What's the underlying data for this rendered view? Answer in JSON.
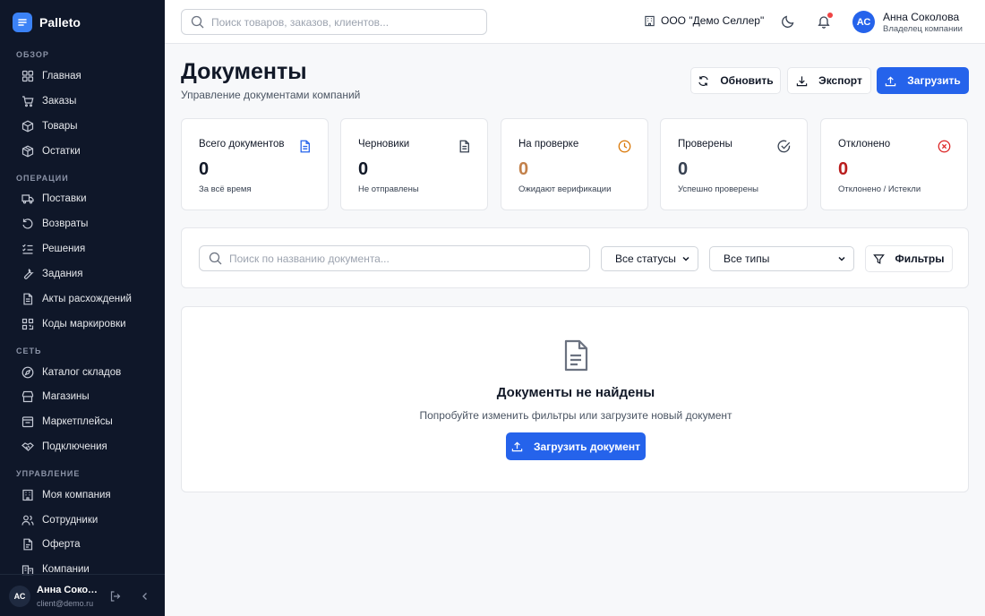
{
  "brand": {
    "name": "Palleto"
  },
  "sidebar": {
    "sections": [
      {
        "title": "ОБЗОР",
        "items": [
          {
            "label": "Главная",
            "icon": "grid-icon"
          },
          {
            "label": "Заказы",
            "icon": "cart-icon"
          },
          {
            "label": "Товары",
            "icon": "box-icon"
          },
          {
            "label": "Остатки",
            "icon": "package-icon"
          }
        ]
      },
      {
        "title": "ОПЕРАЦИИ",
        "items": [
          {
            "label": "Поставки",
            "icon": "truck-icon"
          },
          {
            "label": "Возвраты",
            "icon": "return-icon"
          },
          {
            "label": "Решения",
            "icon": "checklist-icon"
          },
          {
            "label": "Задания",
            "icon": "wrench-icon"
          },
          {
            "label": "Акты расхождений",
            "icon": "document-icon"
          },
          {
            "label": "Коды маркировки",
            "icon": "qr-icon"
          }
        ]
      },
      {
        "title": "СЕТЬ",
        "items": [
          {
            "label": "Каталог складов",
            "icon": "compass-icon"
          },
          {
            "label": "Магазины",
            "icon": "store-icon"
          },
          {
            "label": "Маркетплейсы",
            "icon": "marketplace-icon"
          },
          {
            "label": "Подключения",
            "icon": "handshake-icon"
          }
        ]
      },
      {
        "title": "УПРАВЛЕНИЕ",
        "items": [
          {
            "label": "Моя компания",
            "icon": "building-icon"
          },
          {
            "label": "Сотрудники",
            "icon": "users-icon"
          },
          {
            "label": "Оферта",
            "icon": "file-icon"
          },
          {
            "label": "Компании",
            "icon": "buildings-icon"
          }
        ]
      }
    ],
    "user": {
      "initials": "АС",
      "name": "Анна Соколова",
      "email": "client@demo.ru"
    }
  },
  "topbar": {
    "search_placeholder": "Поиск товаров, заказов, клиентов...",
    "company": "ООО \"Демо Селлер\"",
    "user": {
      "initials": "АС",
      "name": "Анна Соколова",
      "role": "Владелец компании"
    }
  },
  "page": {
    "title": "Документы",
    "subtitle": "Управление документами компаний",
    "actions": {
      "refresh": "Обновить",
      "export": "Экспорт",
      "upload": "Загрузить"
    }
  },
  "stats": [
    {
      "label": "Всего документов",
      "value": "0",
      "note": "За всё время",
      "icon": "document-icon",
      "color": "#2563eb",
      "value_color": "#111827"
    },
    {
      "label": "Черновики",
      "value": "0",
      "note": "Не отправлены",
      "icon": "draft-icon",
      "color": "#374151",
      "value_color": "#111827"
    },
    {
      "label": "На проверке",
      "value": "0",
      "note": "Ожидают верификации",
      "icon": "clock-icon",
      "color": "#d97706",
      "value_color": "#c2804a"
    },
    {
      "label": "Проверены",
      "value": "0",
      "note": "Успешно проверены",
      "icon": "check-circle-icon",
      "color": "#374151",
      "value_color": "#374151"
    },
    {
      "label": "Отклонено",
      "value": "0",
      "note": "Отклонено / Истекли",
      "icon": "x-circle-icon",
      "color": "#dc2626",
      "value_color": "#b91c1c"
    }
  ],
  "filters": {
    "search_placeholder": "Поиск по названию документа...",
    "status": "Все статусы",
    "type": "Все типы",
    "button": "Фильтры"
  },
  "empty": {
    "title": "Документы не найдены",
    "subtitle": "Попробуйте изменить фильтры или загрузите новый документ",
    "button": "Загрузить документ"
  }
}
